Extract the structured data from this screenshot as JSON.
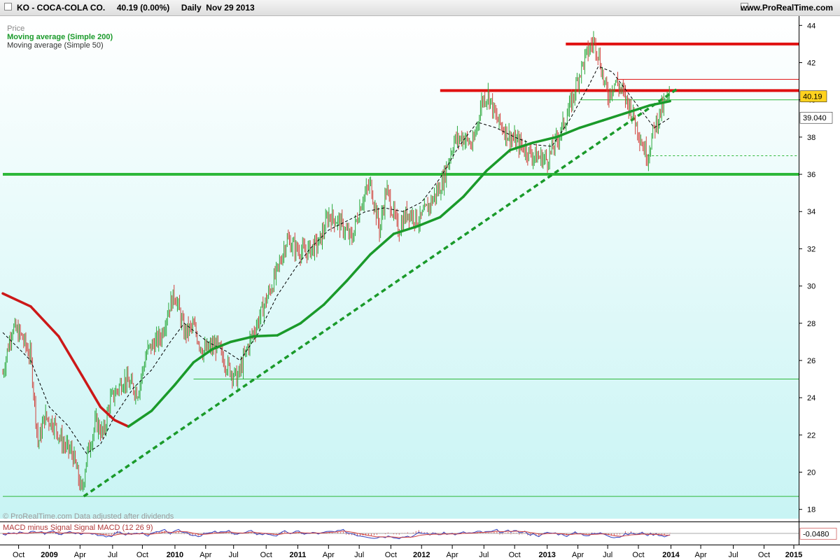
{
  "window": {
    "title": "KO - COCA-COLA CO.     40.19 (0.00%)     Daily  Nov 29 2013",
    "brand": "www.ProRealTime.com"
  },
  "legend": {
    "price": "Price",
    "ma200": "Moving average (Simple 200)",
    "ma50": "Moving average (Simple 50)"
  },
  "footer": "© ProRealTime.com Data adjusted after dividends",
  "macd": {
    "label": "MACD minus Signal Signal MACD (12 26 9)",
    "value_label": "-0.0480"
  },
  "price_labels": {
    "last": "40.19",
    "ma50": "39.040"
  },
  "colors": {
    "bg_top": "#ffffff",
    "bg_bottom": "#c8f4f4",
    "support": "#2db83a",
    "resistance": "#e01010",
    "ma200_up": "#1a9a2a",
    "ma200_down": "#cc1818"
  },
  "chart_data": {
    "type": "line",
    "title": "KO - COCA-COLA CO.",
    "ylim": [
      17.5,
      44.5
    ],
    "y_ticks": [
      18,
      20,
      22,
      24,
      26,
      28,
      30,
      32,
      34,
      36,
      38,
      40,
      42,
      44
    ],
    "x_ticks": [
      {
        "t": 0.17,
        "label": "Oct"
      },
      {
        "t": 0.5,
        "label": "2009"
      },
      {
        "t": 0.83,
        "label": "Apr"
      },
      {
        "t": 1.18,
        "label": "Jul"
      },
      {
        "t": 1.5,
        "label": "Oct"
      },
      {
        "t": 1.85,
        "label": "2010"
      },
      {
        "t": 2.18,
        "label": "Apr"
      },
      {
        "t": 2.48,
        "label": "Jul"
      },
      {
        "t": 2.83,
        "label": "Oct"
      },
      {
        "t": 3.17,
        "label": "2011"
      },
      {
        "t": 3.5,
        "label": "Apr"
      },
      {
        "t": 3.83,
        "label": "Jul"
      },
      {
        "t": 4.17,
        "label": "Oct"
      },
      {
        "t": 4.5,
        "label": "2012"
      },
      {
        "t": 4.83,
        "label": "Apr"
      },
      {
        "t": 5.17,
        "label": "Jul"
      },
      {
        "t": 5.5,
        "label": "Oct"
      },
      {
        "t": 5.85,
        "label": "2013"
      },
      {
        "t": 6.18,
        "label": "Apr"
      },
      {
        "t": 6.5,
        "label": "Jul"
      },
      {
        "t": 6.83,
        "label": "Oct"
      },
      {
        "t": 7.18,
        "label": "2014"
      },
      {
        "t": 7.5,
        "label": "Apr"
      },
      {
        "t": 7.85,
        "label": "Jul"
      },
      {
        "t": 8.18,
        "label": "Oct"
      },
      {
        "t": 8.5,
        "label": "2015"
      }
    ],
    "x_bold_labels": [
      "2009",
      "2010",
      "2011",
      "2012",
      "2013",
      "2014",
      "2015"
    ],
    "series": [
      {
        "name": "Price",
        "points": [
          [
            0,
            25.3
          ],
          [
            0.1,
            27.8
          ],
          [
            0.2,
            27.3
          ],
          [
            0.3,
            26.2
          ],
          [
            0.38,
            21.5
          ],
          [
            0.45,
            23.0
          ],
          [
            0.55,
            22.6
          ],
          [
            0.65,
            21.5
          ],
          [
            0.75,
            21.0
          ],
          [
            0.85,
            18.9
          ],
          [
            0.9,
            20.8
          ],
          [
            1.0,
            22.7
          ],
          [
            1.08,
            22.0
          ],
          [
            1.15,
            23.8
          ],
          [
            1.3,
            25.0
          ],
          [
            1.45,
            24.3
          ],
          [
            1.55,
            26.5
          ],
          [
            1.7,
            27.3
          ],
          [
            1.78,
            28.8
          ],
          [
            1.85,
            29.6
          ],
          [
            1.95,
            27.5
          ],
          [
            2.05,
            27.8
          ],
          [
            2.15,
            26.5
          ],
          [
            2.3,
            26.8
          ],
          [
            2.4,
            25.8
          ],
          [
            2.52,
            25.0
          ],
          [
            2.65,
            27.0
          ],
          [
            2.75,
            28.2
          ],
          [
            2.85,
            29.5
          ],
          [
            2.95,
            30.8
          ],
          [
            3.05,
            32.5
          ],
          [
            3.15,
            32.0
          ],
          [
            3.25,
            31.8
          ],
          [
            3.4,
            32.3
          ],
          [
            3.5,
            33.8
          ],
          [
            3.6,
            33.5
          ],
          [
            3.75,
            32.5
          ],
          [
            3.85,
            34.5
          ],
          [
            3.95,
            35.5
          ],
          [
            4.05,
            33.0
          ],
          [
            4.12,
            35.2
          ],
          [
            4.25,
            33.0
          ],
          [
            4.35,
            34.0
          ],
          [
            4.48,
            33.5
          ],
          [
            4.6,
            34.5
          ],
          [
            4.72,
            35.5
          ],
          [
            4.85,
            37.8
          ],
          [
            4.95,
            38.0
          ],
          [
            5.05,
            37.5
          ],
          [
            5.15,
            40.0
          ],
          [
            5.22,
            40.3
          ],
          [
            5.3,
            39.0
          ],
          [
            5.45,
            38.0
          ],
          [
            5.58,
            37.5
          ],
          [
            5.7,
            37.0
          ],
          [
            5.85,
            36.8
          ],
          [
            5.95,
            37.8
          ],
          [
            6.05,
            39.0
          ],
          [
            6.12,
            40.0
          ],
          [
            6.2,
            41.5
          ],
          [
            6.28,
            42.5
          ],
          [
            6.35,
            43.2
          ],
          [
            6.4,
            42.5
          ],
          [
            6.45,
            41.2
          ],
          [
            6.5,
            40.2
          ],
          [
            6.58,
            41.0
          ],
          [
            6.65,
            40.5
          ],
          [
            6.75,
            39.5
          ],
          [
            6.82,
            38.5
          ],
          [
            6.88,
            37.5
          ],
          [
            6.93,
            37.0
          ],
          [
            7.0,
            38.5
          ],
          [
            7.08,
            39.5
          ],
          [
            7.17,
            40.19
          ]
        ],
        "color": "#2aa83a"
      },
      {
        "name": "Moving average (Simple 50)",
        "points": [
          [
            0,
            27.5
          ],
          [
            0.3,
            26.0
          ],
          [
            0.5,
            23.5
          ],
          [
            0.7,
            22.5
          ],
          [
            0.9,
            21.0
          ],
          [
            1.05,
            21.5
          ],
          [
            1.2,
            23.0
          ],
          [
            1.4,
            24.5
          ],
          [
            1.6,
            25.5
          ],
          [
            1.8,
            27.0
          ],
          [
            1.95,
            28.0
          ],
          [
            2.2,
            27.0
          ],
          [
            2.4,
            26.5
          ],
          [
            2.55,
            26.0
          ],
          [
            2.75,
            27.5
          ],
          [
            2.95,
            29.5
          ],
          [
            3.15,
            31.0
          ],
          [
            3.3,
            32.0
          ],
          [
            3.5,
            33.0
          ],
          [
            3.7,
            33.5
          ],
          [
            3.9,
            34.0
          ],
          [
            4.1,
            34.2
          ],
          [
            4.3,
            34.0
          ],
          [
            4.5,
            34.5
          ],
          [
            4.7,
            35.8
          ],
          [
            4.9,
            37.5
          ],
          [
            5.1,
            38.8
          ],
          [
            5.3,
            38.5
          ],
          [
            5.5,
            38.0
          ],
          [
            5.7,
            37.6
          ],
          [
            5.9,
            37.5
          ],
          [
            6.1,
            39.0
          ],
          [
            6.3,
            40.8
          ],
          [
            6.4,
            41.8
          ],
          [
            6.55,
            41.5
          ],
          [
            6.7,
            40.5
          ],
          [
            6.85,
            39.5
          ],
          [
            7.0,
            38.5
          ],
          [
            7.17,
            39.04
          ]
        ],
        "color": "#000000"
      },
      {
        "name": "Moving average (Simple 200)",
        "points": [
          [
            0,
            29.6
          ],
          [
            0.3,
            28.9
          ],
          [
            0.6,
            27.3
          ],
          [
            0.85,
            25.2
          ],
          [
            1.05,
            23.5
          ],
          [
            1.2,
            22.8
          ],
          [
            1.35,
            22.45
          ],
          [
            1.6,
            23.3
          ],
          [
            1.85,
            24.7
          ],
          [
            2.05,
            25.9
          ],
          [
            2.25,
            26.6
          ],
          [
            2.45,
            27.0
          ],
          [
            2.7,
            27.3
          ],
          [
            2.95,
            27.35
          ],
          [
            3.2,
            28.0
          ],
          [
            3.45,
            29.0
          ],
          [
            3.7,
            30.3
          ],
          [
            3.95,
            31.7
          ],
          [
            4.2,
            32.8
          ],
          [
            4.45,
            33.2
          ],
          [
            4.7,
            33.7
          ],
          [
            4.95,
            34.8
          ],
          [
            5.2,
            36.2
          ],
          [
            5.45,
            37.3
          ],
          [
            5.7,
            37.7
          ],
          [
            5.95,
            38.0
          ],
          [
            6.2,
            38.5
          ],
          [
            6.45,
            38.9
          ],
          [
            6.7,
            39.3
          ],
          [
            6.95,
            39.7
          ],
          [
            7.17,
            39.93
          ]
        ],
        "color": "#1a9a2a"
      }
    ],
    "horizontal_levels": [
      {
        "y": 43.0,
        "x_start": 6.05,
        "color": "#e01010",
        "style": "thick"
      },
      {
        "y": 40.5,
        "x_start": 4.7,
        "color": "#e01010",
        "style": "thick"
      },
      {
        "y": 41.1,
        "x_start": 6.6,
        "color": "#e01010",
        "style": "thin"
      },
      {
        "y": 40.0,
        "x_start": 6.2,
        "color": "#2db83a",
        "style": "thin"
      },
      {
        "y": 37.0,
        "x_start": 6.93,
        "color": "#2db83a",
        "style": "dashed"
      },
      {
        "y": 36.0,
        "x_start": 0,
        "color": "#2db83a",
        "style": "thick"
      },
      {
        "y": 25.0,
        "x_start": 2.05,
        "color": "#2db83a",
        "style": "thin"
      },
      {
        "y": 18.7,
        "x_start": 0,
        "color": "#2db83a",
        "style": "thin"
      }
    ],
    "trendline": {
      "from": [
        0.87,
        18.7
      ],
      "to": [
        7.25,
        40.6
      ],
      "color": "#1a9a2a",
      "style": "dashed"
    },
    "macd_panel": {
      "ylim": [
        -0.6,
        0.6
      ],
      "value": -0.048
    }
  }
}
